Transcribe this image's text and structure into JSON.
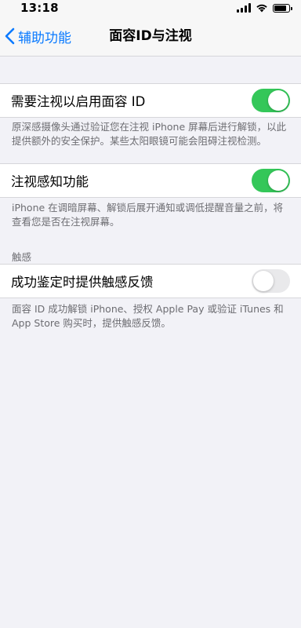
{
  "status_bar": {
    "time": "13:18",
    "signal_bars": 4,
    "battery_level": 0.9
  },
  "nav": {
    "back_label": "辅助功能",
    "title": "面容ID与注视",
    "accent": "#0a7aff"
  },
  "settings": [
    {
      "label": "需要注视以启用面容 ID",
      "enabled": true,
      "footer": "原深感摄像头通过验证您在注视 iPhone 屏幕后进行解锁，以此提供额外的安全保护。某些太阳眼镜可能会阻碍注视检测。"
    },
    {
      "label": "注视感知功能",
      "enabled": true,
      "footer": "iPhone 在调暗屏幕、解锁后展开通知或调低提醒音量之前，将查看您是否在注视屏幕。"
    },
    {
      "section_header": "触感",
      "label": "成功鉴定时提供触感反馈",
      "enabled": false,
      "footer": "面容 ID 成功解锁 iPhone、授权 Apple Pay 或验证 iTunes 和 App Store 购买时，提供触感反馈。"
    }
  ],
  "colors": {
    "toggle_on": "#34c759",
    "toggle_off": "#e9e9eb",
    "background": "#f2f2f7"
  }
}
